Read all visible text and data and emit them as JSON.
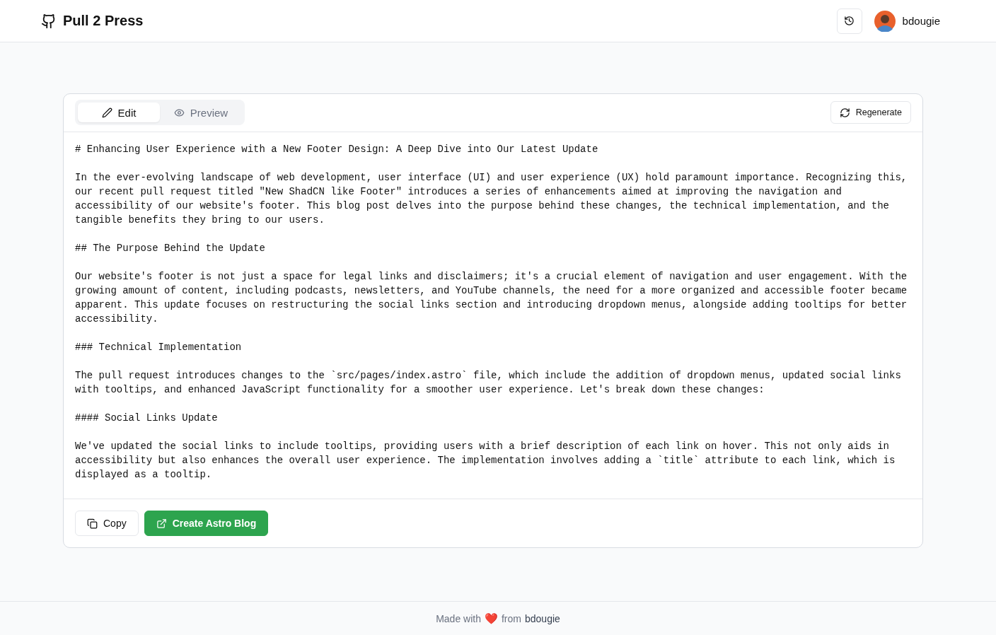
{
  "header": {
    "title": "Pull 2 Press",
    "username": "bdougie"
  },
  "tabs": [
    {
      "label": "Edit",
      "kind": "edit",
      "selected": true
    },
    {
      "label": "Preview",
      "kind": "preview",
      "selected": false
    }
  ],
  "regenerate_button": "Regenerate",
  "editor": {
    "paragraphs": [
      "# Enhancing User Experience with a New Footer Design: A Deep Dive into Our Latest Update",
      "In the ever-evolving landscape of web development, user interface (UI) and user experience (UX) hold paramount importance. Recognizing this, our recent pull request titled \"New ShadCN like Footer\" introduces a series of enhancements aimed at improving the navigation and accessibility of our website's footer. This blog post delves into the purpose behind these changes, the technical implementation, and the tangible benefits they bring to our users.",
      "## The Purpose Behind the Update",
      "Our website's footer is not just a space for legal links and disclaimers; it's a crucial element of navigation and user engagement. With the growing amount of content, including podcasts, newsletters, and YouTube channels, the need for a more organized and accessible footer became apparent. This update focuses on restructuring the social links section and introducing dropdown menus, alongside adding tooltips for better accessibility.",
      "### Technical Implementation",
      "The pull request introduces changes to the `src/pages/index.astro` file, which include the addition of dropdown menus, updated social links with tooltips, and enhanced JavaScript functionality for a smoother user experience. Let's break down these changes:",
      "#### Social Links Update",
      "We've updated the social links to include tooltips, providing users with a brief description of each link on hover. This not only aids in accessibility but also enhances the overall user experience. The implementation involves adding a `title` attribute to each link, which is displayed as a tooltip."
    ]
  },
  "actions": [
    {
      "label": "Copy",
      "kind": "copy"
    },
    {
      "label": "Create Astro Blog",
      "kind": "create"
    }
  ],
  "footer": {
    "prefix": "Made with",
    "heart": "❤️",
    "middle": "from",
    "author": "bdougie"
  }
}
